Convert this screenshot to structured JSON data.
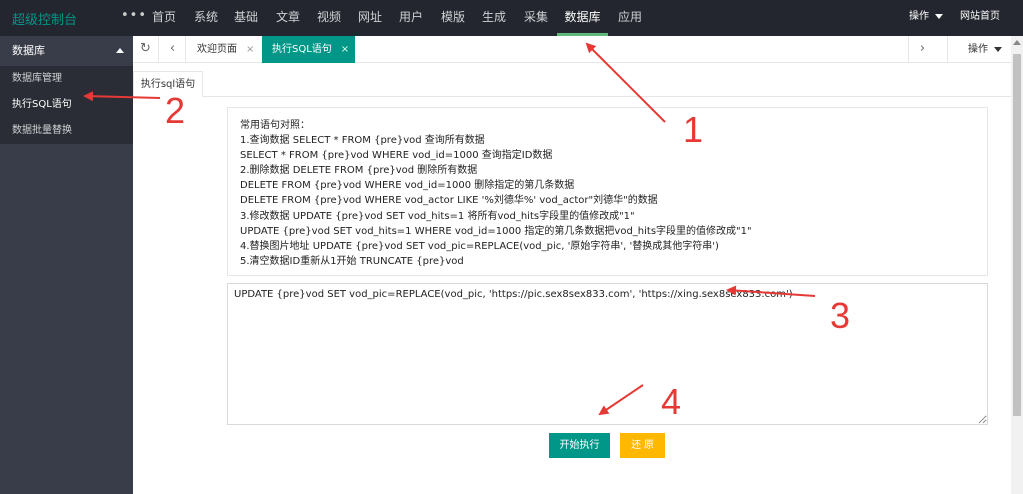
{
  "header": {
    "logo": "超级控制台",
    "more": "•••",
    "nav": [
      "首页",
      "系统",
      "基础",
      "文章",
      "视频",
      "网址",
      "用户",
      "模版",
      "生成",
      "采集",
      "数据库",
      "应用"
    ],
    "nav_active_index": 10,
    "operate": "操作",
    "site_home": "网站首页"
  },
  "sidebar": {
    "group": "数据库",
    "items": [
      "数据库管理",
      "执行SQL语句",
      "数据批量替换"
    ],
    "active_index": 1
  },
  "tabs": {
    "refresh_icon": "refresh-icon",
    "items": [
      {
        "label": "欢迎页面",
        "close": "×"
      },
      {
        "label": "执行SQL语句",
        "close": "×"
      }
    ],
    "active_index": 1,
    "operate": "操作"
  },
  "page": {
    "subtab": "执行sql语句",
    "reference_lines": [
      "常用语句对照：",
      "1.查询数据 SELECT * FROM {pre}vod 查询所有数据",
      "SELECT * FROM {pre}vod WHERE vod_id=1000 查询指定ID数据",
      "2.删除数据 DELETE FROM {pre}vod 删除所有数据",
      "DELETE FROM {pre}vod WHERE vod_id=1000 删除指定的第几条数据",
      "DELETE FROM {pre}vod WHERE vod_actor LIKE '%刘德华%' vod_actor\"刘德华\"的数据",
      "3.修改数据 UPDATE {pre}vod SET vod_hits=1 将所有vod_hits字段里的值修改成\"1\"",
      "UPDATE {pre}vod SET vod_hits=1 WHERE vod_id=1000 指定的第几条数据把vod_hits字段里的值修改成\"1\"",
      "4.替换图片地址 UPDATE {pre}vod SET vod_pic=REPLACE(vod_pic, '原始字符串', '替换成其他字符串')",
      "5.清空数据ID重新从1开始 TRUNCATE {pre}vod"
    ],
    "sql_value": "UPDATE {pre}vod SET vod_pic=REPLACE(vod_pic, 'https://pic.sex8sex833.com', 'https://xing.sex8sex833.com')",
    "execute_label": "开始执行",
    "reset_label": "还 原"
  },
  "annotations": [
    "1",
    "2",
    "3",
    "4"
  ],
  "colors": {
    "topbar": "#23262e",
    "sidebar": "#393d49",
    "accent": "#009688",
    "warn": "#ffb800",
    "nav_underline": "#5fb878",
    "annotation": "#e53935"
  }
}
